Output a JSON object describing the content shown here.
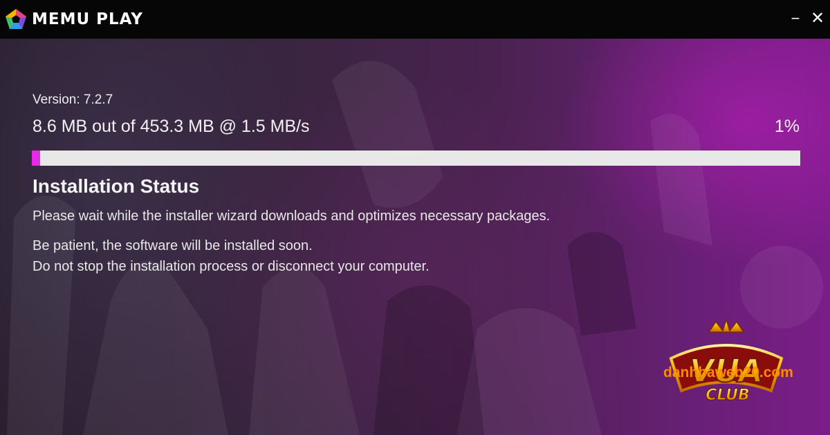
{
  "titlebar": {
    "brand": "MEMU PLAY",
    "logo_icon": "memu-pentagon-logo",
    "minimize_label": "−",
    "close_label": "✕"
  },
  "installer": {
    "version_text": "Version: 7.2.7",
    "progress_text": "8.6 MB out of 453.3 MB @ 1.5 MB/s",
    "progress_percent_text": "1%",
    "progress_fraction": 0.01,
    "status_heading": "Installation Status",
    "status_lines": [
      "Please wait while the installer wizard downloads and optimizes necessary packages.",
      "Be patient, the software will be installed soon.",
      "Do not stop the installation process or disconnect your computer."
    ]
  },
  "watermark": {
    "logo_text_main": "VUA",
    "logo_text_sub": "CLUB",
    "site": "danhbaweb20.com"
  },
  "colors": {
    "accent": "#e62ae6",
    "titlebar_bg": "#060606",
    "watermark_orange": "#ff8a00"
  }
}
